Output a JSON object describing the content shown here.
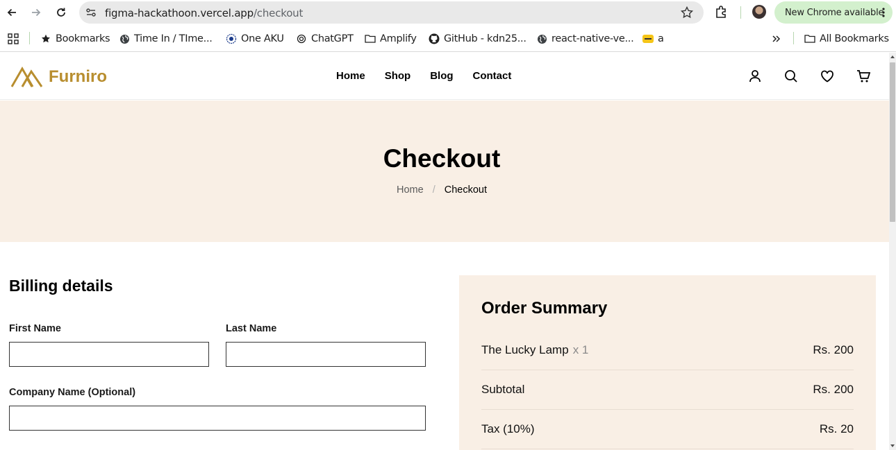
{
  "browser": {
    "url_host": "figma-hackathoon.vercel.app",
    "url_path": "/checkout",
    "update_label": "New Chrome available",
    "bookmarks": [
      {
        "label": "Bookmarks",
        "icon": "star-icon"
      },
      {
        "label": "Time In / TIme...",
        "icon": "globe-icon"
      },
      {
        "label": "One AKU",
        "icon": "aku-icon"
      },
      {
        "label": "ChatGPT",
        "icon": "chatgpt-icon"
      },
      {
        "label": "Amplify",
        "icon": "folder-icon"
      },
      {
        "label": "GitHub - kdn25...",
        "icon": "github-icon"
      },
      {
        "label": "react-native-ve...",
        "icon": "globe-icon"
      },
      {
        "label": "a",
        "icon": "bookmark-favicon"
      }
    ],
    "all_bookmarks_label": "All Bookmarks"
  },
  "site": {
    "brand": "Furniro",
    "brand_color": "#b88e2f",
    "nav": [
      "Home",
      "Shop",
      "Blog",
      "Contact"
    ],
    "header_icons": [
      "user-icon",
      "search-icon",
      "heart-icon",
      "cart-icon"
    ]
  },
  "hero": {
    "title": "Checkout",
    "breadcrumb_home": "Home",
    "breadcrumb_sep": "/",
    "breadcrumb_current": "Checkout",
    "background": "#f9efe5"
  },
  "billing": {
    "title": "Billing details",
    "first_name_label": "First Name",
    "first_name_value": "",
    "last_name_label": "Last Name",
    "last_name_value": "",
    "company_label": "Company Name (Optional)",
    "company_value": ""
  },
  "summary": {
    "title": "Order Summary",
    "item_name": "The Lucky Lamp",
    "item_qty": "x 1",
    "item_price": "Rs. 200",
    "subtotal_label": "Subtotal",
    "subtotal_value": "Rs. 200",
    "tax_label": "Tax (10%)",
    "tax_value": "Rs. 20"
  }
}
